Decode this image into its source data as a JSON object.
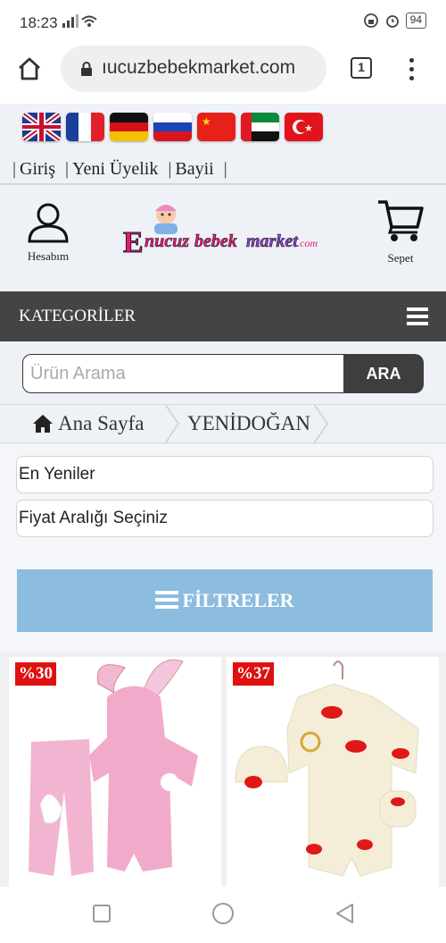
{
  "status": {
    "time": "18:23",
    "battery": "94"
  },
  "browser": {
    "url": "ıucuzbebekmarket.com",
    "tab_count": "1"
  },
  "flags": [
    "uk-flag",
    "france-flag",
    "germany-flag",
    "russia-flag",
    "china-flag",
    "uae-flag",
    "turkey-flag"
  ],
  "top_links": {
    "login": "Giriş",
    "register": "Yeni Üyelik",
    "dealer": "Bayii",
    "sep": "|"
  },
  "header": {
    "account_label": "Hesabım",
    "cart_label": "Sepet",
    "logo_text": "Enucuzbebekmarket.com"
  },
  "category_bar": {
    "label": "KATEGORİLER"
  },
  "search": {
    "placeholder": "Ürün Arama",
    "button": "ARA"
  },
  "breadcrumb": {
    "home": "Ana Sayfa",
    "current": "YENİDOĞAN"
  },
  "filters": {
    "sort": "En Yeniler",
    "price": "Fiyat Aralığı Seçiniz",
    "button": "FİLTRELER"
  },
  "products": [
    {
      "discount": "%30",
      "image": "pink bunny hoodie baby set"
    },
    {
      "discount": "%37",
      "image": "cream newborn set with red bows"
    }
  ],
  "colors": {
    "category_bar": "#444444",
    "filter_button": "#8cbcdf",
    "badge": "#e01010"
  }
}
